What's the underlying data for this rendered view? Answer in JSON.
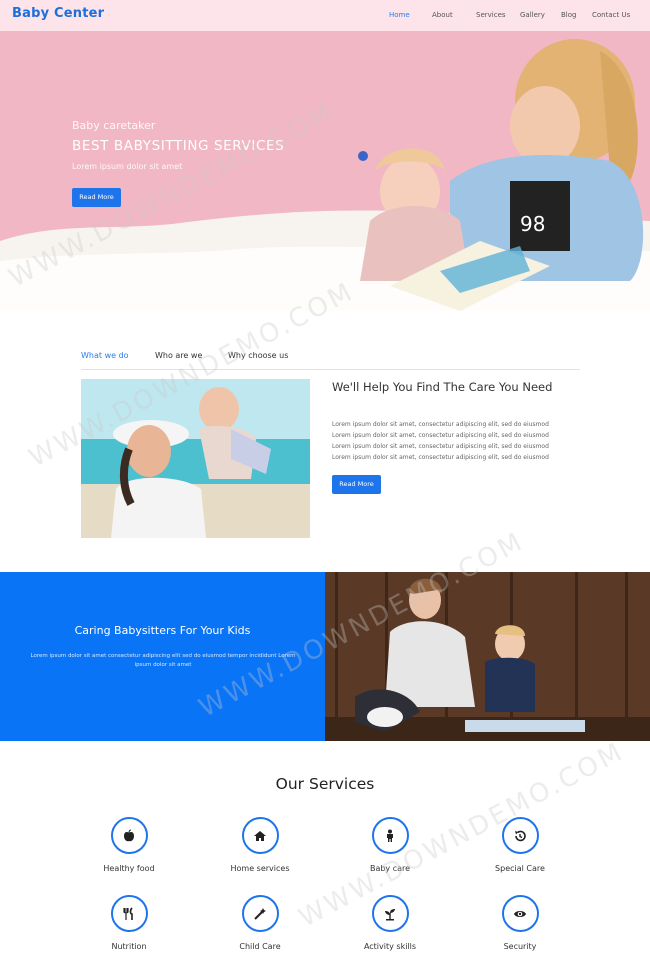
{
  "nav": {
    "brand": "Baby Center",
    "items": [
      {
        "label": "Home",
        "active": true
      },
      {
        "label": "About",
        "active": false
      },
      {
        "label": "Services",
        "active": false
      },
      {
        "label": "Gallery",
        "active": false
      },
      {
        "label": "Blog",
        "active": false
      },
      {
        "label": "Contact Us",
        "active": false
      }
    ]
  },
  "hero": {
    "kicker": "Baby caretaker",
    "title": "BEST BABYSITTING SERVICES",
    "subtitle": "Lorem ipsum dolor sit amet",
    "button": "Read More"
  },
  "tabs": {
    "items": [
      {
        "label": "What we do",
        "active": true
      },
      {
        "label": "Who are we",
        "active": false
      },
      {
        "label": "Why choose us",
        "active": false
      }
    ],
    "content": {
      "title": "We'll Help You Find The Care You Need",
      "lines": [
        "Lorem ipsum dolor sit amet, consectetur adipiscing elit, sed do eiusmod",
        "Lorem ipsum dolor sit amet, consectetur adipiscing elit, sed do eiusmod",
        "Lorem ipsum dolor sit amet, consectetur adipiscing elit, sed do eiusmod",
        "Lorem ipsum dolor sit amet, consectetur adipiscing elit, sed do eiusmod"
      ],
      "button": "Read More"
    }
  },
  "band": {
    "title": "Caring Babysitters For Your Kids",
    "text": "Lorem ipsum dolor sit amet consectetur adipiscing elit sed do eiusmod tempor incididunt Lorem ipsum dolor sit amet"
  },
  "services": {
    "title": "Our Services",
    "items": [
      {
        "label": "Healthy food",
        "icon": "apple-icon"
      },
      {
        "label": "Home services",
        "icon": "home-icon"
      },
      {
        "label": "Baby care",
        "icon": "child-icon"
      },
      {
        "label": "Special Care",
        "icon": "history-icon"
      },
      {
        "label": "Nutrition",
        "icon": "utensils-icon"
      },
      {
        "label": "Child Care",
        "icon": "magic-wand-icon"
      },
      {
        "label": "Activity skills",
        "icon": "plant-icon"
      },
      {
        "label": "Security",
        "icon": "eye-icon"
      }
    ]
  },
  "watermark": "WWW.DOWNDEMO.COM",
  "colors": {
    "accent": "#1e74ea",
    "band": "#0a74f7",
    "nav_bg": "#fde4ea",
    "hero_bg": "#f2b7c4"
  }
}
